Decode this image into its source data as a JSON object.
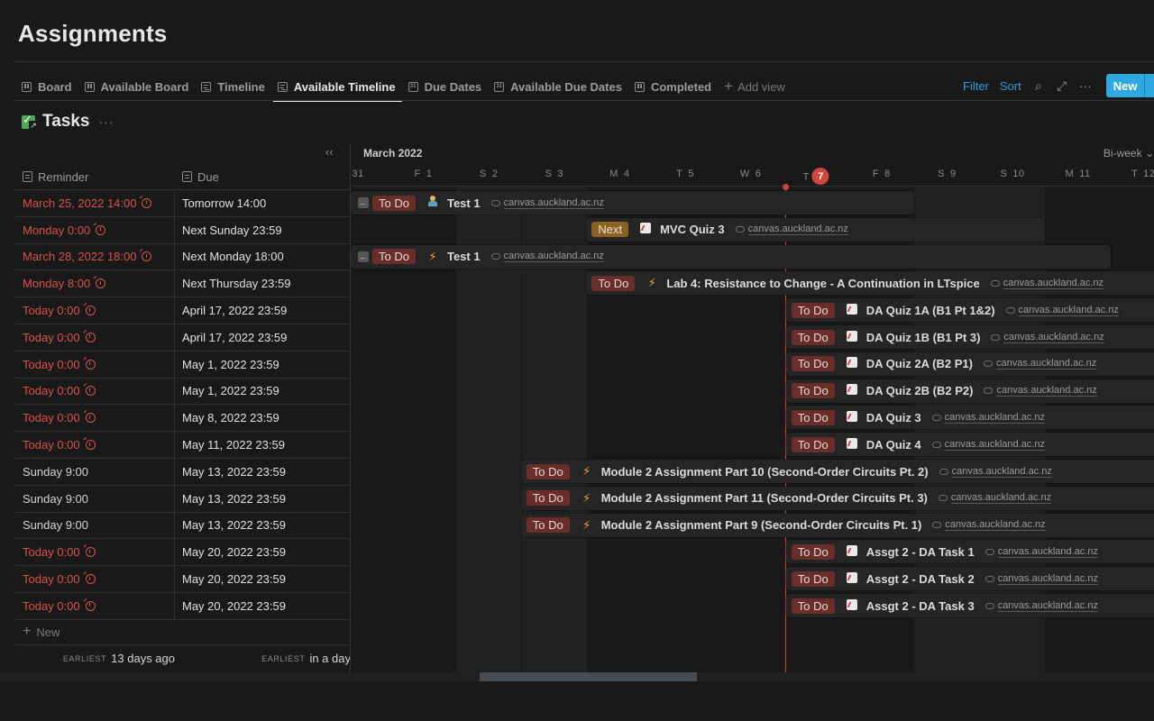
{
  "page": {
    "title": "Assignments"
  },
  "views": [
    {
      "label": "Board",
      "icon": "board-icon",
      "active": false
    },
    {
      "label": "Available Board",
      "icon": "board-icon",
      "active": false
    },
    {
      "label": "Timeline",
      "icon": "timeline-icon",
      "active": false
    },
    {
      "label": "Available Timeline",
      "icon": "timeline-icon",
      "active": true
    },
    {
      "label": "Due Dates",
      "icon": "calendar-icon",
      "active": false
    },
    {
      "label": "Available Due Dates",
      "icon": "calendar-icon",
      "active": false
    },
    {
      "label": "Completed",
      "icon": "board-icon",
      "active": false
    }
  ],
  "add_view_label": "Add view",
  "toolbar": {
    "filter": "Filter",
    "sort": "Sort",
    "search_icon": "⌕",
    "expand_icon": "⤢",
    "more_icon": "···",
    "new_label": "New",
    "new_dropdown_icon": "⌄"
  },
  "database": {
    "title": "Tasks",
    "more_icon": "···",
    "collapse_icon": "‹‹"
  },
  "table": {
    "columns": [
      {
        "label": "Reminder"
      },
      {
        "label": "Due"
      }
    ],
    "rows": [
      {
        "reminder": "March 25, 2022 14:00",
        "reminder_overdue": true,
        "due": "Tomorrow 14:00"
      },
      {
        "reminder": "Monday 0:00",
        "reminder_overdue": true,
        "due": "Next Sunday 23:59"
      },
      {
        "reminder": "March 28, 2022 18:00",
        "reminder_overdue": true,
        "due": "Next Monday 18:00"
      },
      {
        "reminder": "Monday 8:00",
        "reminder_overdue": true,
        "due": "Next Thursday 23:59"
      },
      {
        "reminder": "Today 0:00",
        "reminder_overdue": true,
        "due": "April 17, 2022 23:59"
      },
      {
        "reminder": "Today 0:00",
        "reminder_overdue": true,
        "due": "April 17, 2022 23:59"
      },
      {
        "reminder": "Today 0:00",
        "reminder_overdue": true,
        "due": "May 1, 2022 23:59"
      },
      {
        "reminder": "Today 0:00",
        "reminder_overdue": true,
        "due": "May 1, 2022 23:59"
      },
      {
        "reminder": "Today 0:00",
        "reminder_overdue": true,
        "due": "May 8, 2022 23:59"
      },
      {
        "reminder": "Today 0:00",
        "reminder_overdue": true,
        "due": "May 11, 2022 23:59"
      },
      {
        "reminder": "Sunday 9:00",
        "reminder_overdue": false,
        "due": "May 13, 2022 23:59"
      },
      {
        "reminder": "Sunday 9:00",
        "reminder_overdue": false,
        "due": "May 13, 2022 23:59"
      },
      {
        "reminder": "Sunday 9:00",
        "reminder_overdue": false,
        "due": "May 13, 2022 23:59"
      },
      {
        "reminder": "Today 0:00",
        "reminder_overdue": true,
        "due": "May 20, 2022 23:59"
      },
      {
        "reminder": "Today 0:00",
        "reminder_overdue": true,
        "due": "May 20, 2022 23:59"
      },
      {
        "reminder": "Today 0:00",
        "reminder_overdue": true,
        "due": "May 20, 2022 23:59"
      }
    ],
    "new_row_label": "New",
    "calculations": [
      {
        "label": "Earliest",
        "value": "13 days ago"
      },
      {
        "label": "Earliest",
        "value": "in a day"
      }
    ]
  },
  "timeline": {
    "month_label": "March 2022",
    "scale": "Bi-week",
    "today_day": 7,
    "days": [
      {
        "dow": "",
        "num": "31",
        "weekend": false
      },
      {
        "dow": "F",
        "num": "1",
        "weekend": false
      },
      {
        "dow": "S",
        "num": "2",
        "weekend": true
      },
      {
        "dow": "S",
        "num": "3",
        "weekend": true
      },
      {
        "dow": "M",
        "num": "4",
        "weekend": false
      },
      {
        "dow": "T",
        "num": "5",
        "weekend": false
      },
      {
        "dow": "W",
        "num": "6",
        "weekend": false
      },
      {
        "dow": "T",
        "num": "7",
        "weekend": false,
        "today": true
      },
      {
        "dow": "F",
        "num": "8",
        "weekend": false
      },
      {
        "dow": "S",
        "num": "9",
        "weekend": true
      },
      {
        "dow": "S",
        "num": "10",
        "weekend": true
      },
      {
        "dow": "M",
        "num": "11",
        "weekend": false
      },
      {
        "dow": "T",
        "num": "12",
        "weekend": false
      }
    ],
    "items": [
      {
        "status": "To Do",
        "status_kind": "todo",
        "emoji": "person",
        "name": "Test 1",
        "link": "canvas.auckland.ac.nz",
        "start": -0.1,
        "end": 8.5,
        "off_left": true
      },
      {
        "status": "Next",
        "status_kind": "next",
        "emoji": "chart",
        "name": "MVC Quiz 3",
        "link": "canvas.auckland.ac.nz",
        "start": 3.6,
        "end": 10.5,
        "off_left": false
      },
      {
        "status": "To Do",
        "status_kind": "todo",
        "emoji": "bolt",
        "name": "Test 1",
        "link": "canvas.auckland.ac.nz",
        "start": -0.1,
        "end": 11.5,
        "off_left": true
      },
      {
        "status": "To Do",
        "status_kind": "todo",
        "emoji": "bolt",
        "name": "Lab 4: Resistance to Change - A Continuation in LTspice",
        "link": "canvas.auckland.ac.nz",
        "start": 3.6,
        "end": 14,
        "off_left": false
      },
      {
        "status": "To Do",
        "status_kind": "todo",
        "emoji": "chart",
        "name": "DA Quiz 1A (B1 Pt 1&2)",
        "link": "canvas.auckland.ac.nz",
        "start": 6.65,
        "end": 14,
        "off_left": false
      },
      {
        "status": "To Do",
        "status_kind": "todo",
        "emoji": "chart",
        "name": "DA Quiz 1B (B1 Pt 3)",
        "link": "canvas.auckland.ac.nz",
        "start": 6.65,
        "end": 14,
        "off_left": false
      },
      {
        "status": "To Do",
        "status_kind": "todo",
        "emoji": "chart",
        "name": "DA Quiz 2A (B2 P1)",
        "link": "canvas.auckland.ac.nz",
        "start": 6.65,
        "end": 14,
        "off_left": false
      },
      {
        "status": "To Do",
        "status_kind": "todo",
        "emoji": "chart",
        "name": "DA Quiz 2B (B2 P2)",
        "link": "canvas.auckland.ac.nz",
        "start": 6.65,
        "end": 14,
        "off_left": false
      },
      {
        "status": "To Do",
        "status_kind": "todo",
        "emoji": "chart",
        "name": "DA Quiz 3",
        "link": "canvas.auckland.ac.nz",
        "start": 6.65,
        "end": 14,
        "off_left": false
      },
      {
        "status": "To Do",
        "status_kind": "todo",
        "emoji": "chart",
        "name": "DA Quiz 4",
        "link": "canvas.auckland.ac.nz",
        "start": 6.65,
        "end": 14,
        "off_left": false
      },
      {
        "status": "To Do",
        "status_kind": "todo",
        "emoji": "bolt",
        "name": "Module 2 Assignment Part 10 (Second-Order Circuits Pt. 2)",
        "link": "canvas.auckland.ac.nz",
        "start": 2.6,
        "end": 14,
        "off_left": false
      },
      {
        "status": "To Do",
        "status_kind": "todo",
        "emoji": "bolt",
        "name": "Module 2 Assignment Part 11 (Second-Order Circuits Pt. 3)",
        "link": "canvas.auckland.ac.nz",
        "start": 2.6,
        "end": 14,
        "off_left": false
      },
      {
        "status": "To Do",
        "status_kind": "todo",
        "emoji": "bolt",
        "name": "Module 2 Assignment Part 9 (Second-Order Circuits Pt. 1)",
        "link": "canvas.auckland.ac.nz",
        "start": 2.6,
        "end": 14,
        "off_left": false
      },
      {
        "status": "To Do",
        "status_kind": "todo",
        "emoji": "chart",
        "name": "Assgt 2 - DA Task 1",
        "link": "canvas.auckland.ac.nz",
        "start": 6.65,
        "end": 14,
        "off_left": false
      },
      {
        "status": "To Do",
        "status_kind": "todo",
        "emoji": "chart",
        "name": "Assgt 2 - DA Task 2",
        "link": "canvas.auckland.ac.nz",
        "start": 6.65,
        "end": 14,
        "off_left": false
      },
      {
        "status": "To Do",
        "status_kind": "todo",
        "emoji": "chart",
        "name": "Assgt 2 - DA Task 3",
        "link": "canvas.auckland.ac.nz",
        "start": 6.65,
        "end": 14,
        "off_left": false
      }
    ]
  }
}
